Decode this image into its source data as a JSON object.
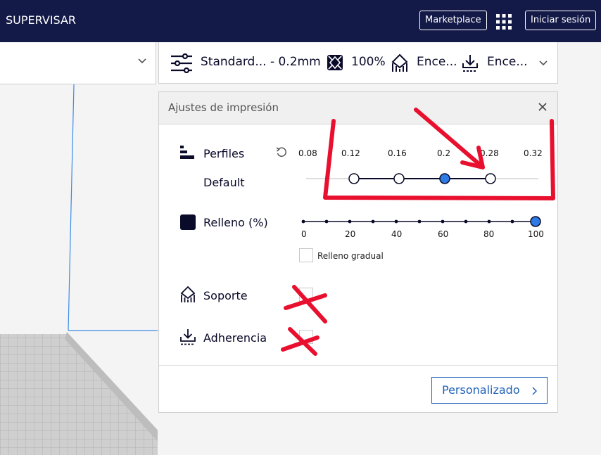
{
  "header": {
    "title": "SUPERVISAR",
    "marketplace_label": "Marketplace",
    "login_label": "Iniciar sesión"
  },
  "print_bar": {
    "profile_label": "Standard... - 0.2mm",
    "infill_label": "100%",
    "support_label": "Ence...",
    "adhesion_label": "Ence..."
  },
  "panel": {
    "title": "Ajustes de impresión",
    "profiles": {
      "label": "Perfiles",
      "current": "Default",
      "ticks": [
        "0.08",
        "0.12",
        "0.16",
        "0.2",
        "0.28",
        "0.32"
      ],
      "selected": "0.2"
    },
    "infill": {
      "label": "Relleno (%)",
      "ticks": [
        "0",
        "20",
        "40",
        "60",
        "80",
        "100"
      ],
      "value": 100,
      "gradual_label": "Relleno gradual",
      "gradual_checked": false
    },
    "support": {
      "label": "Soporte",
      "checked": false
    },
    "adhesion": {
      "label": "Adherencia",
      "checked": false
    },
    "custom_button": "Personalizado"
  },
  "colors": {
    "topbar": "#141a48",
    "accent": "#2061b8",
    "dark": "#0a0a2a",
    "annotation": "#e8102e"
  },
  "icons": {
    "grid": "apps-grid-icon",
    "profile": "sliders-icon",
    "infill": "infill-pattern-icon",
    "support": "support-icon",
    "adhesion": "adhesion-icon"
  }
}
